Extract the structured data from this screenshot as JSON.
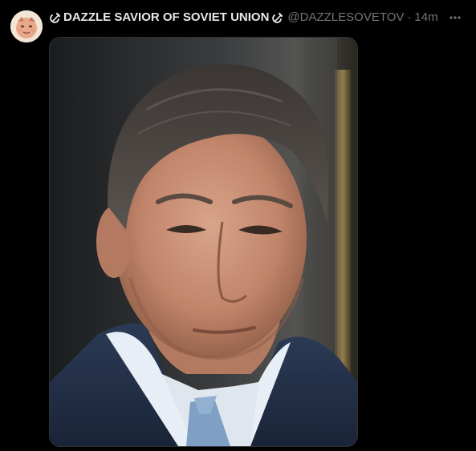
{
  "post": {
    "author_avatar": "avatar-image",
    "display_name": "DAZZLE SAVIOR OF SOVIET UNION",
    "name_prefix_icon": "hammer-and-sickle-icon",
    "name_suffix_icon": "hammer-and-sickle-icon",
    "handle": "@DAZZLESOVETOV",
    "separator": "·",
    "timestamp": "14m",
    "more_icon": "more-horizontal-icon",
    "media_icon": "photo-portrait"
  },
  "colors": {
    "background": "#000000",
    "primary_text": "#e7e9ea",
    "secondary_text": "#71767b",
    "border": "#2f3336"
  }
}
